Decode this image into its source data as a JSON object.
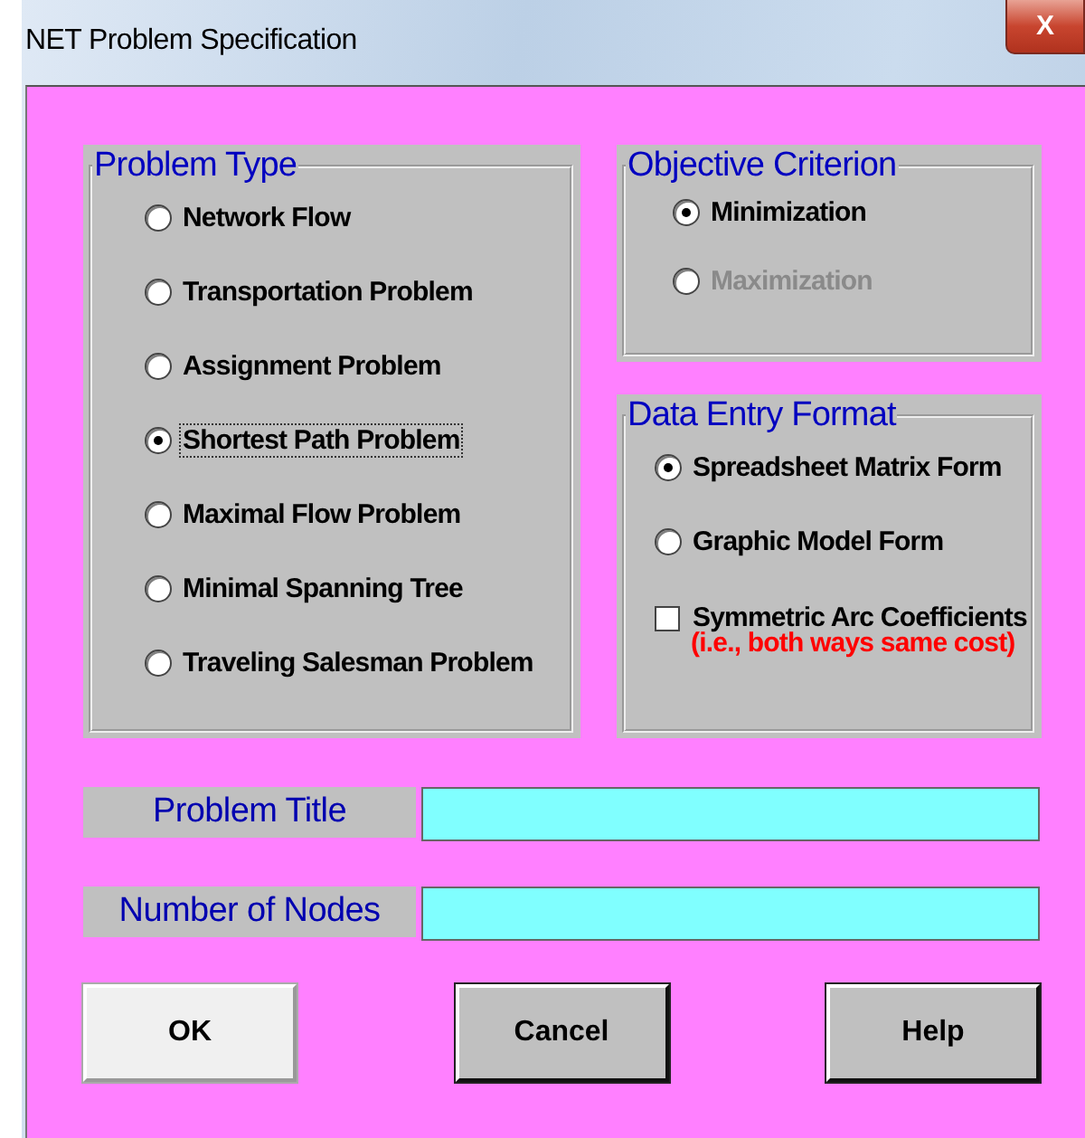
{
  "window": {
    "title": "NET Problem Specification",
    "close": "X"
  },
  "problem_type": {
    "title": "Problem Type",
    "options": [
      {
        "label": "Network Flow",
        "selected": false,
        "focused": false
      },
      {
        "label": "Transportation Problem",
        "selected": false,
        "focused": false
      },
      {
        "label": "Assignment Problem",
        "selected": false,
        "focused": false
      },
      {
        "label": "Shortest Path Problem",
        "selected": true,
        "focused": true
      },
      {
        "label": "Maximal Flow Problem",
        "selected": false,
        "focused": false
      },
      {
        "label": "Minimal Spanning Tree",
        "selected": false,
        "focused": false
      },
      {
        "label": "Traveling Salesman Problem",
        "selected": false,
        "focused": false
      }
    ]
  },
  "objective_criterion": {
    "title": "Objective Criterion",
    "options": [
      {
        "label": "Minimization",
        "selected": true,
        "disabled": false
      },
      {
        "label": "Maximization",
        "selected": false,
        "disabled": true
      }
    ]
  },
  "data_entry_format": {
    "title": "Data Entry Format",
    "items": [
      {
        "kind": "radio",
        "label": "Spreadsheet Matrix Form",
        "selected": true
      },
      {
        "kind": "radio",
        "label": "Graphic Model Form",
        "selected": false
      },
      {
        "kind": "checkbox",
        "label": "Symmetric Arc Coefficients",
        "note": "(i.e., both ways same cost)",
        "checked": false
      }
    ]
  },
  "fields": [
    {
      "label": "Problem Title"
    },
    {
      "label": "Number of Nodes"
    }
  ],
  "buttons": [
    {
      "label": "OK",
      "focused": true
    },
    {
      "label": "Cancel",
      "focused": false
    },
    {
      "label": "Help",
      "focused": false
    }
  ]
}
